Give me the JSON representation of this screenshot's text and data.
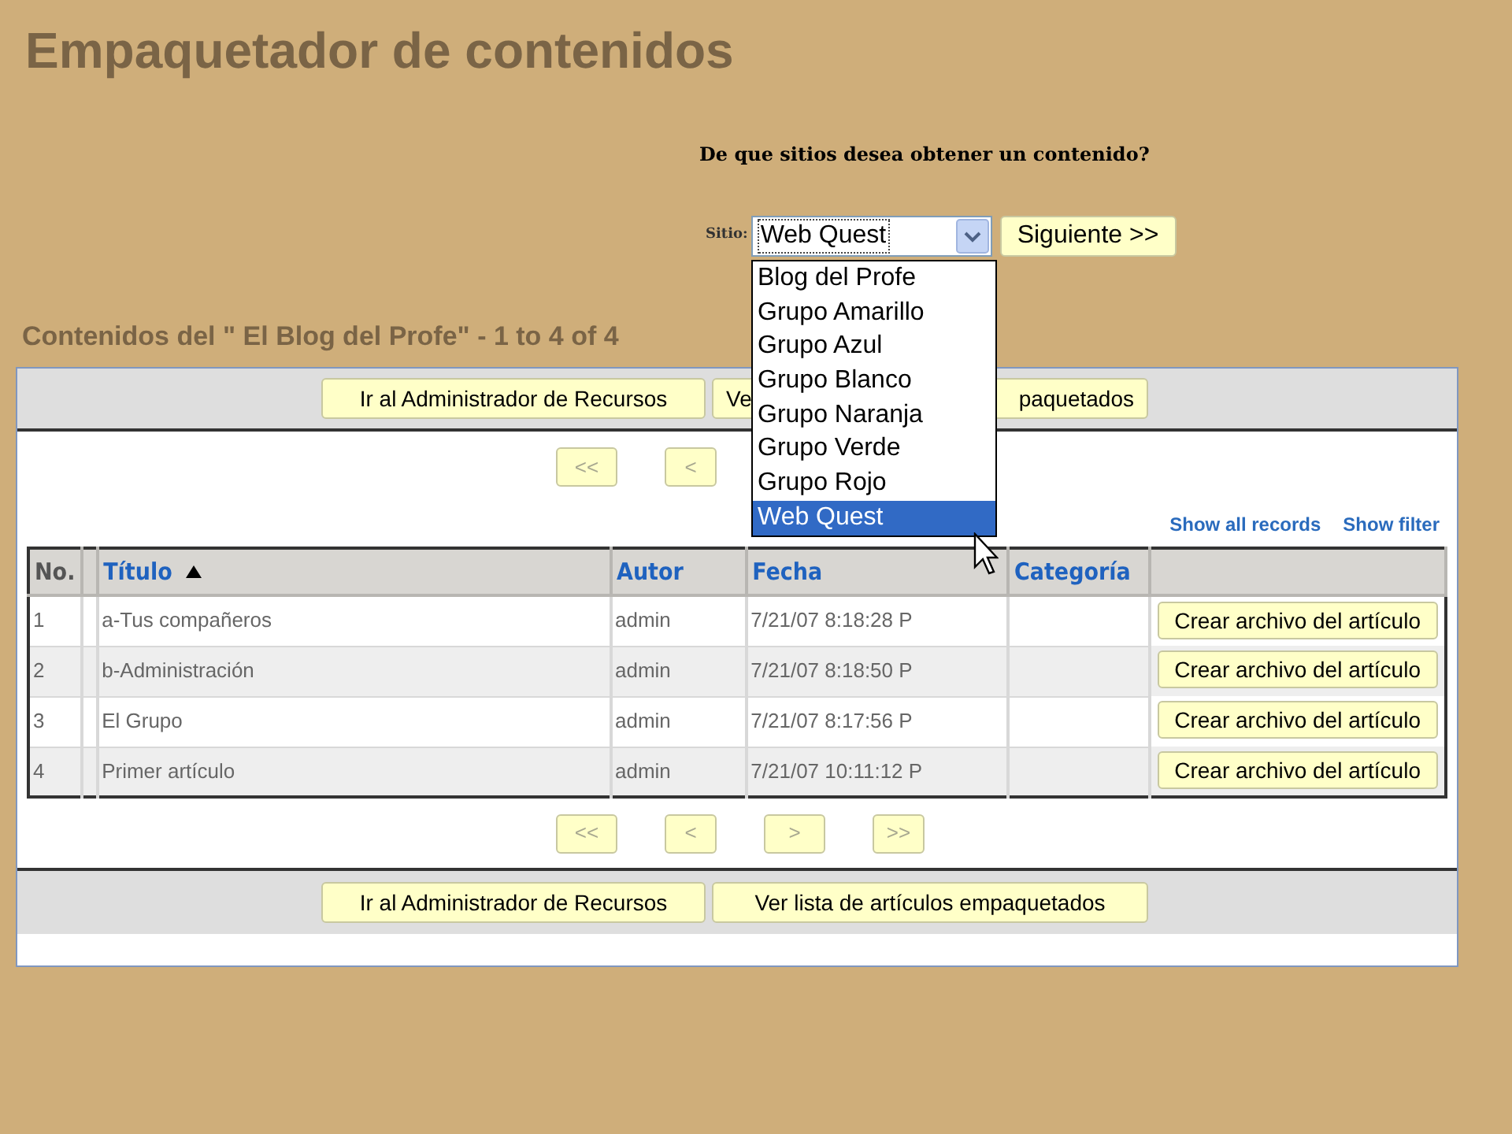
{
  "page_title": "Empaquetador de contenidos",
  "site_picker": {
    "question": "De que sitios desea obtener un contenido?",
    "label": "Sitio:",
    "value": "Web Quest",
    "button": "Siguiente >>",
    "options": [
      {
        "label": "Blog del Profe",
        "selected": false
      },
      {
        "label": "Grupo Amarillo",
        "selected": false
      },
      {
        "label": "Grupo Azul",
        "selected": false
      },
      {
        "label": "Grupo Blanco",
        "selected": false
      },
      {
        "label": "Grupo Naranja",
        "selected": false
      },
      {
        "label": "Grupo Verde",
        "selected": false
      },
      {
        "label": "Grupo Rojo",
        "selected": false
      },
      {
        "label": "Web Quest",
        "selected": true
      }
    ]
  },
  "section_title": "Contenidos del \" El Blog del Profe\" - 1 to 4 of 4",
  "top_toolbar": [
    {
      "label": "Ir al Administrador de Recursos"
    },
    {
      "label_parts": [
        "Ve",
        "paquetados"
      ]
    }
  ],
  "top_pager": [
    "<<",
    "<"
  ],
  "links": [
    "Show all records",
    "Show filter"
  ],
  "table": {
    "columns": [
      {
        "label": "No.",
        "kind": "plain"
      },
      {
        "kind": "blank"
      },
      {
        "label": "Título",
        "kind": "sorted"
      },
      {
        "label": "Autor",
        "kind": "link"
      },
      {
        "label": "Fecha",
        "kind": "link"
      },
      {
        "label": "Categoría",
        "kind": "link"
      },
      {
        "kind": "blank"
      }
    ],
    "rows": [
      {
        "no": "1",
        "title": "a-Tus compañeros",
        "author": "admin",
        "date": "7/21/07 8:18:28 P",
        "action": "Crear archivo del artículo"
      },
      {
        "no": "2",
        "title": "b-Administración",
        "author": "admin",
        "date": "7/21/07 8:18:50 P",
        "action": "Crear archivo del artículo"
      },
      {
        "no": "3",
        "title": "El Grupo",
        "author": "admin",
        "date": "7/21/07 8:17:56 P",
        "action": "Crear archivo del artículo"
      },
      {
        "no": "4",
        "title": "Primer artículo",
        "author": "admin",
        "date": "7/21/07 10:11:12 P",
        "action": "Crear archivo del artículo"
      }
    ]
  },
  "bottom_pager": [
    "<<",
    "<",
    ">",
    ">>"
  ],
  "bottom_toolbar": [
    "Ir al Administrador de Recursos",
    "Ver lista de artículos empaquetados"
  ]
}
